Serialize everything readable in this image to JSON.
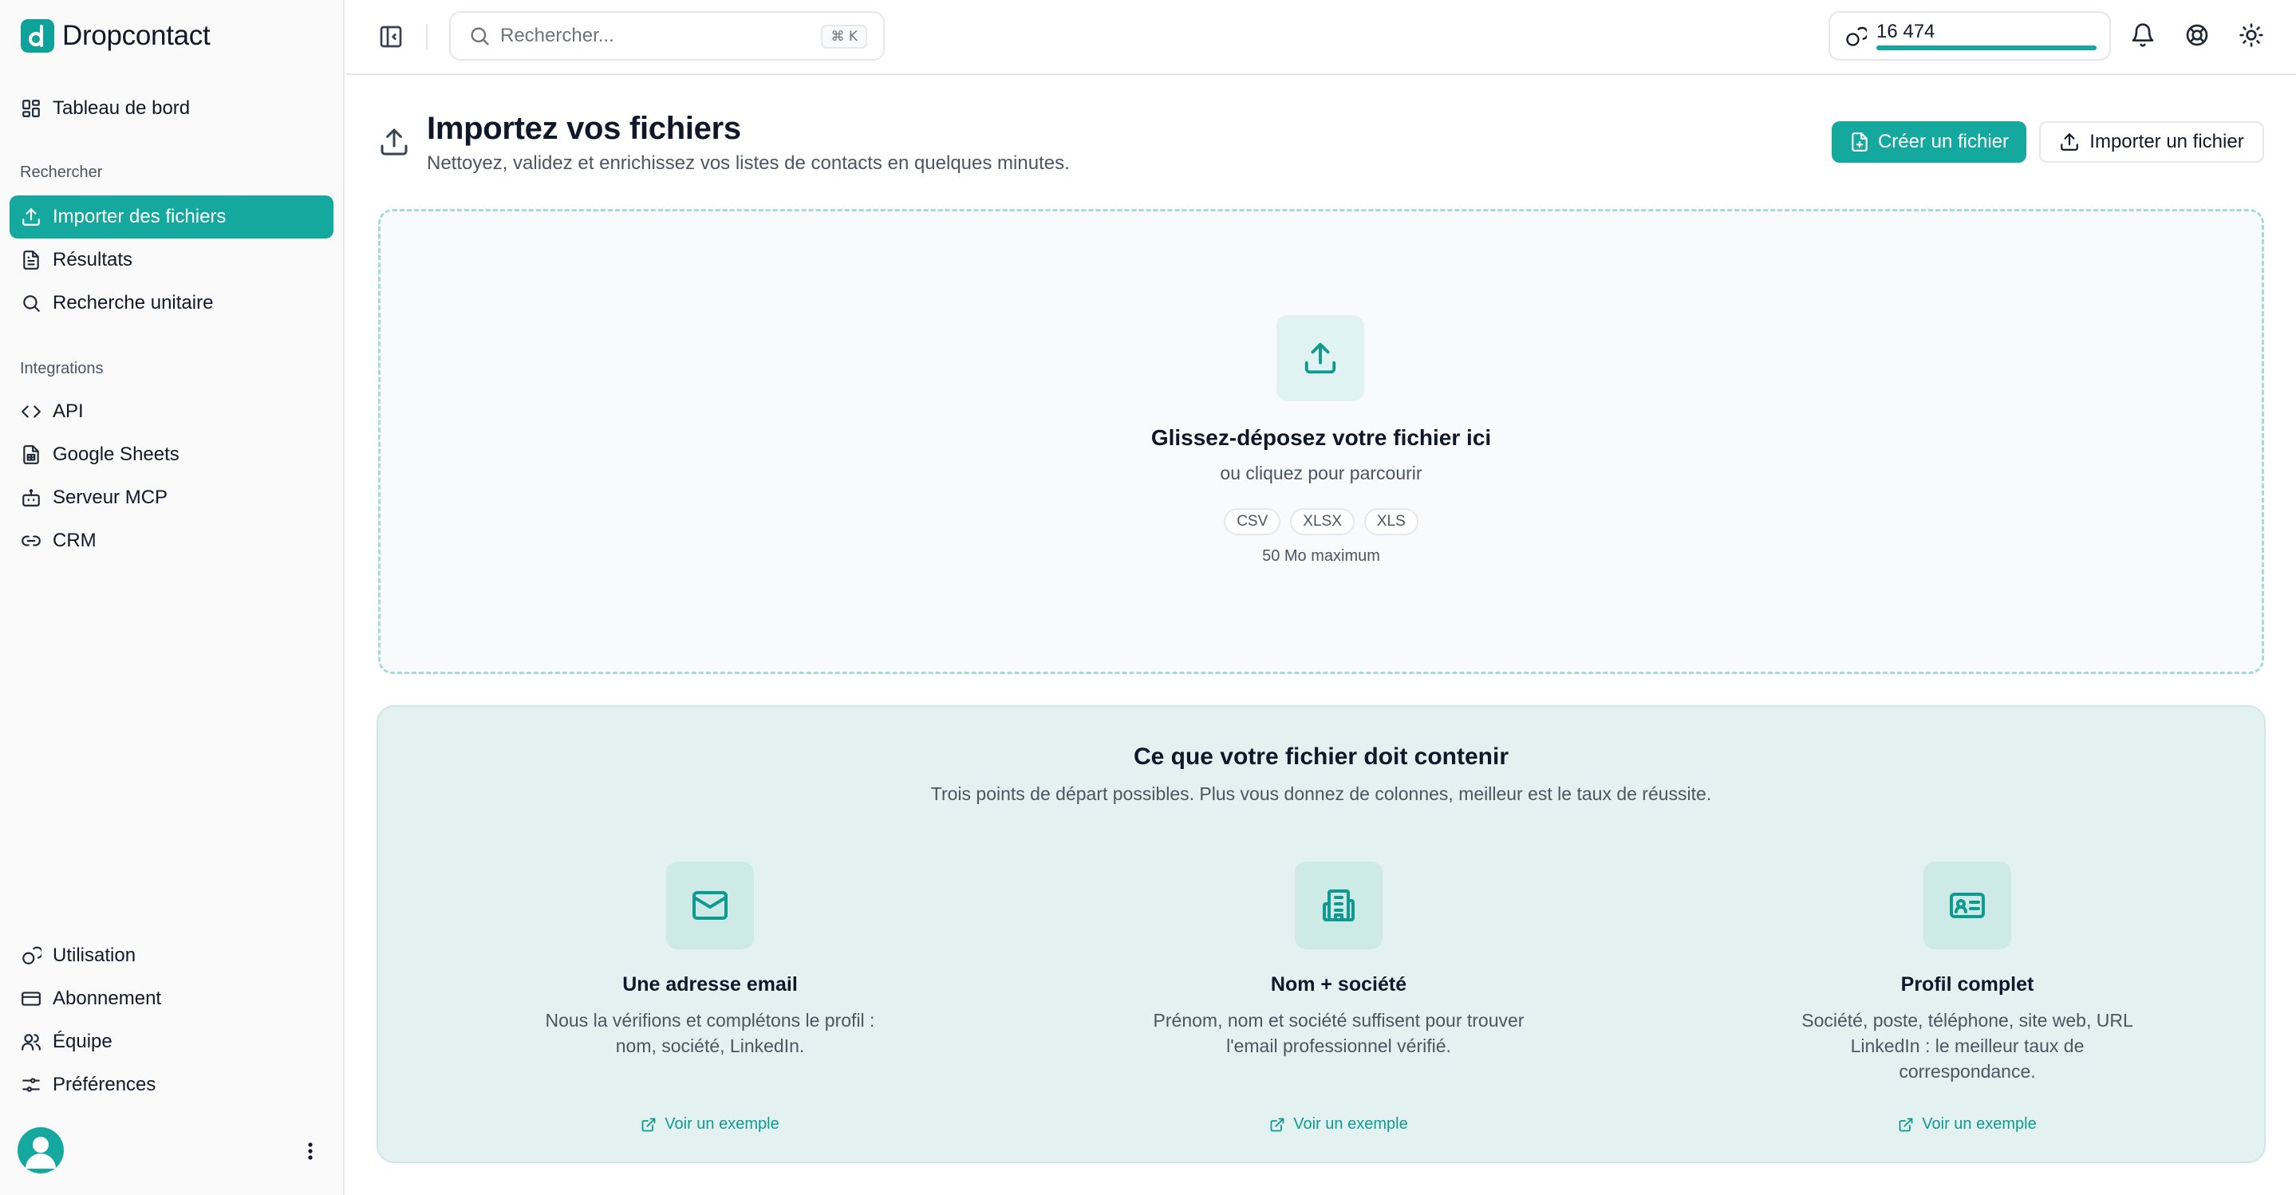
{
  "app": {
    "name": "Dropcontact",
    "brand_color": "#15a89e"
  },
  "sidebar": {
    "dashboard": {
      "label": "Tableau de bord",
      "icon": "dashboard-icon"
    },
    "search_section": "Rechercher",
    "search_items": [
      {
        "label": "Importer des fichiers",
        "icon": "upload-icon",
        "active": true
      },
      {
        "label": "Résultats",
        "icon": "file-text-icon",
        "active": false
      },
      {
        "label": "Recherche unitaire",
        "icon": "search-icon",
        "active": false
      }
    ],
    "integrations_section": "Integrations",
    "integration_items": [
      {
        "label": "API",
        "icon": "code-icon"
      },
      {
        "label": "Google Sheets",
        "icon": "sheet-icon"
      },
      {
        "label": "Serveur MCP",
        "icon": "bot-icon"
      },
      {
        "label": "CRM",
        "icon": "link-icon"
      }
    ],
    "bottom_items": [
      {
        "label": "Utilisation",
        "icon": "coins-icon"
      },
      {
        "label": "Abonnement",
        "icon": "credit-card-icon"
      },
      {
        "label": "Équipe",
        "icon": "users-icon"
      },
      {
        "label": "Préférences",
        "icon": "sliders-icon"
      }
    ]
  },
  "topbar": {
    "search_placeholder": "Rechercher...",
    "search_shortcut": "⌘ K",
    "credits": "16 474",
    "credits_fill": 1.0
  },
  "header": {
    "title": "Importez vos fichiers",
    "subtitle": "Nettoyez, validez et enrichissez vos listes de contacts en quelques minutes.",
    "create_button": "Créer un fichier",
    "import_button": "Importer un fichier"
  },
  "dropzone": {
    "title": "Glissez-déposez votre fichier ici",
    "subtitle": "ou cliquez pour parcourir",
    "formats": [
      "CSV",
      "XLSX",
      "XLS"
    ],
    "max_size": "50 Mo maximum"
  },
  "requirements": {
    "title": "Ce que votre fichier doit contenir",
    "subtitle": "Trois points de départ possibles. Plus vous donnez de colonnes, meilleur est le taux de réussite.",
    "cards": [
      {
        "title": "Une adresse email",
        "description": "Nous la vérifions et complétons le profil : nom, société, LinkedIn.",
        "link": "Voir un exemple",
        "icon": "mail-icon"
      },
      {
        "title": "Nom + société",
        "description": "Prénom, nom et société suffisent pour trouver l'email professionnel vérifié.",
        "link": "Voir un exemple",
        "icon": "building-icon"
      },
      {
        "title": "Profil complet",
        "description": "Société, poste, téléphone, site web, URL LinkedIn : le meilleur taux de correspondance.",
        "link": "Voir un exemple",
        "icon": "id-card-icon"
      }
    ]
  }
}
